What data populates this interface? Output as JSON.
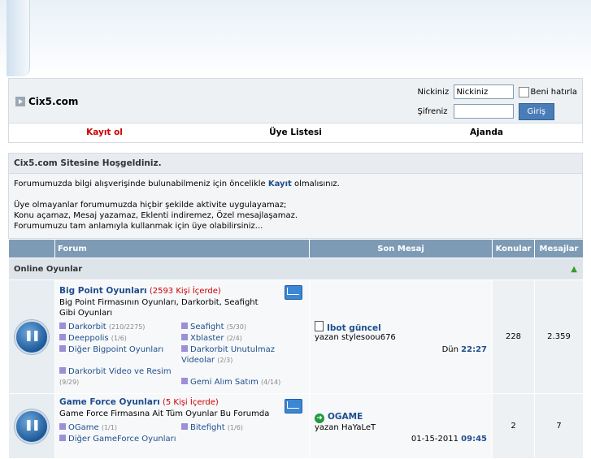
{
  "site": {
    "title": "Cix5.com"
  },
  "login": {
    "nick_label": "Nickiniz",
    "nick_value": "Nickiniz",
    "remember_label": "Beni hatırla",
    "password_label": "Şifreniz",
    "submit_label": "Giriş"
  },
  "menu": {
    "register": "Kayıt ol",
    "members": "Üye Listesi",
    "calendar": "Ajanda"
  },
  "welcome": {
    "title": "Cix5.com Sitesine Hoşgeldiniz.",
    "line1_pre": "Forumumuzda bilgi alışverişinde bulunabilmeniz için öncelikle",
    "line1_link": "Kayıt",
    "line1_post": "olmalısınız.",
    "line2": "Üye olmayanlar forumumuzda hiçbir şekilde aktivite uygulayamaz;",
    "line3": "Konu açamaz, Mesaj yazamaz, Eklenti indiremez, Özel mesajlaşamaz.",
    "line4": "Forumumuzu tam anlamıyla kullanmak için üye olabilirsiniz..."
  },
  "table": {
    "headers": {
      "forum": "Forum",
      "last": "Son Mesaj",
      "topics": "Konular",
      "posts": "Mesajlar"
    },
    "category": "Online Oyunlar",
    "rows": [
      {
        "title": "Big Point Oyunları",
        "count": "(2593 Kişi İçerde)",
        "desc": "Big Point Firmasının Oyunları, Darkorbit, Seafight Gibi Oyunları",
        "subs": [
          {
            "name": "Darkorbit",
            "n": "(210/2275)"
          },
          {
            "name": "Seafight",
            "n": "(5/30)"
          },
          {
            "name": "Deeppolis",
            "n": "(1/6)"
          },
          {
            "name": "Xblaster",
            "n": "(2/4)"
          },
          {
            "name": "Diğer Bigpoint Oyunları",
            "n": ""
          },
          {
            "name": "Darkorbit Unutulmaz Videolar",
            "n": "(2/3)"
          },
          {
            "name": "Darkorbit Video ve Resim",
            "n": "(9/29)"
          },
          {
            "name": "Gemi Alım Satım",
            "n": "(4/14)"
          }
        ],
        "last_title": "Ibot güncel",
        "last_by": "yazan stylesoou676",
        "last_date": "Dün",
        "last_time": "22:27",
        "topics": "228",
        "posts": "2.359"
      },
      {
        "title": "Game Force Oyunları",
        "count": "(5 Kişi İçerde)",
        "desc": "Game Force Firmasına Ait Tüm Oyunlar Bu Forumda",
        "subs": [
          {
            "name": "OGame",
            "n": "(1/1)"
          },
          {
            "name": "Bitefight",
            "n": "(1/6)"
          },
          {
            "name": "Diğer GameForce Oyunları",
            "n": ""
          }
        ],
        "last_title": "OGAME",
        "last_by": "yazan HaYaLeT",
        "last_date": "01-15-2011",
        "last_time": "09:45",
        "topics": "2",
        "posts": "7"
      }
    ]
  }
}
